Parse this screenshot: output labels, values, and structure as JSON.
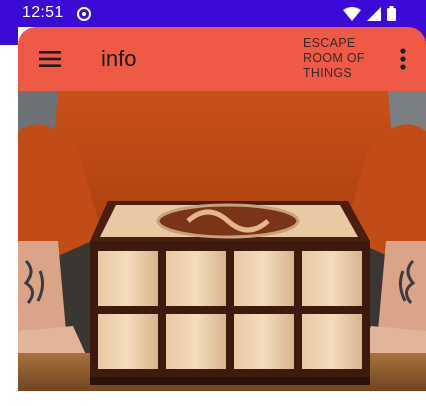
{
  "status_bar": {
    "time": "12:51",
    "background": "#3b0ad6",
    "icons": [
      "notification-icon",
      "wifi-icon",
      "signal-icon",
      "battery-icon"
    ]
  },
  "app_bar": {
    "title": "info",
    "action_label": "ESCAPE ROOM OF THINGS",
    "background": "#ef5a47",
    "icons": [
      "menu-icon",
      "overflow-menu-icon"
    ]
  },
  "hero": {
    "subject": "person in orange sweater leaning on a wooden puzzle box with a swirling logo on the lid"
  }
}
